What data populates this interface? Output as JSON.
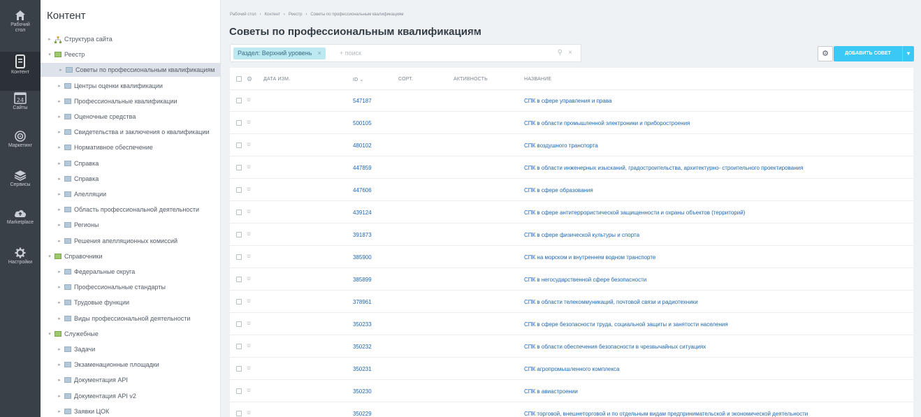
{
  "left_nav": [
    {
      "label_1": "Рабочий",
      "label_2": "стол",
      "icon": "home-icon"
    },
    {
      "label_1": "Контент",
      "label_2": "",
      "icon": "content-icon"
    },
    {
      "label_1": "Сайты",
      "label_2": "",
      "icon": "calendar-icon",
      "badge": "24"
    },
    {
      "label_1": "Маркетинг",
      "label_2": "",
      "icon": "target-icon"
    },
    {
      "label_1": "Сервисы",
      "label_2": "",
      "icon": "layers-icon"
    },
    {
      "label_1": "Marketplace",
      "label_2": "",
      "icon": "cloud-upload-icon"
    },
    {
      "label_1": "Настройки",
      "label_2": "",
      "icon": "gear-icon"
    }
  ],
  "tree": {
    "title": "Контент",
    "nodes": [
      {
        "label": "Структура сайта",
        "level": 0,
        "arrow": "▸",
        "icon": "sitemap"
      },
      {
        "label": "Реестр",
        "level": 0,
        "arrow": "▾",
        "icon": "green"
      },
      {
        "label": "Советы по профессиональным квалификациям",
        "level": 1,
        "arrow": "▸",
        "icon": "folder",
        "selected": true
      },
      {
        "label": "Центры оценки квалификации",
        "level": 1,
        "arrow": "▸",
        "icon": "folder"
      },
      {
        "label": "Профессиональные квалификации",
        "level": 1,
        "arrow": "▸",
        "icon": "folder"
      },
      {
        "label": "Оценочные средства",
        "level": 1,
        "arrow": "▸",
        "icon": "folder"
      },
      {
        "label": "Свидетельства и заключения о квалификации",
        "level": 1,
        "arrow": "▸",
        "icon": "folder"
      },
      {
        "label": "Нормативное обеспечение",
        "level": 1,
        "arrow": "▸",
        "icon": "folder"
      },
      {
        "label": "Справка",
        "level": 1,
        "arrow": "▸",
        "icon": "folder"
      },
      {
        "label": "Справка",
        "level": 1,
        "arrow": "▸",
        "icon": "folder"
      },
      {
        "label": "Апелляции",
        "level": 1,
        "arrow": "▸",
        "icon": "folder"
      },
      {
        "label": "Область профессиональной деятельности",
        "level": 1,
        "arrow": "▸",
        "icon": "folder"
      },
      {
        "label": "Регионы",
        "level": 1,
        "arrow": "▸",
        "icon": "folder"
      },
      {
        "label": "Решения апелляционных комиссий",
        "level": 1,
        "arrow": "▸",
        "icon": "folder"
      },
      {
        "label": "Справочники",
        "level": 0,
        "arrow": "▾",
        "icon": "green"
      },
      {
        "label": "Федеральные округа",
        "level": 1,
        "arrow": "▸",
        "icon": "folder"
      },
      {
        "label": "Профессиональные стандарты",
        "level": 1,
        "arrow": "▸",
        "icon": "folder"
      },
      {
        "label": "Трудовые функции",
        "level": 1,
        "arrow": "▸",
        "icon": "folder"
      },
      {
        "label": "Виды профессиональной деятельности",
        "level": 1,
        "arrow": "▸",
        "icon": "folder"
      },
      {
        "label": "Служебные",
        "level": 0,
        "arrow": "▾",
        "icon": "green"
      },
      {
        "label": "Задачи",
        "level": 1,
        "arrow": "▸",
        "icon": "folder"
      },
      {
        "label": "Экзаменационные площадки",
        "level": 1,
        "arrow": "▸",
        "icon": "folder"
      },
      {
        "label": "Документация API",
        "level": 1,
        "arrow": "▸",
        "icon": "folder"
      },
      {
        "label": "Документация API v2",
        "level": 1,
        "arrow": "▸",
        "icon": "folder"
      },
      {
        "label": "Заявки ЦОК",
        "level": 1,
        "arrow": "▸",
        "icon": "folder"
      }
    ]
  },
  "breadcrumbs": [
    "Рабочий стол",
    "Контент",
    "Реестр",
    "Советы по профессиональным квалификациям"
  ],
  "breadcrumb_sep": "›",
  "page_title": "Советы по профессиональным квалификациям",
  "star": "☆",
  "filter": {
    "chip_label": "Раздел: Верхний уровень",
    "chip_close": "×",
    "search_placeholder": "+ поиск",
    "search_icon": "⚲",
    "clear_icon": "×"
  },
  "toolbar": {
    "settings_icon": "⚙",
    "add_label": "ДОБАВИТЬ СОВЕТ",
    "dropdown_arrow": "▾"
  },
  "table": {
    "columns": [
      "ДАТА ИЗМ.",
      "ID ⌄",
      "СОРТ.",
      "АКТИВНОСТЬ",
      "НАЗВАНИЕ"
    ],
    "settings_icon": "⚙",
    "row_menu_icon": "≡",
    "rows": [
      {
        "id": "547187",
        "name": "СПК в сфере управления и права"
      },
      {
        "id": "500105",
        "name": "СПК в области промышленной электроники и приборостроения"
      },
      {
        "id": "480102",
        "name": "СПК воздушного транспорта"
      },
      {
        "id": "447859",
        "name": "СПК в области инженерных изысканий, градостроительства, архитектурно- строительного проектирования"
      },
      {
        "id": "447606",
        "name": "СПК в сфере образования"
      },
      {
        "id": "439124",
        "name": "СПК в сфере антитеррористической защищенности и охраны объектов (территорий)"
      },
      {
        "id": "391873",
        "name": "СПК в сфере физической культуры и спорта"
      },
      {
        "id": "385900",
        "name": "СПК на морском и внутреннем водном транспорте"
      },
      {
        "id": "385899",
        "name": "СПК в негосударственной сфере безопасности"
      },
      {
        "id": "378961",
        "name": "СПК в области телекоммуникаций, почтовой связи и радиотехники"
      },
      {
        "id": "350233",
        "name": "СПК в сфере безопасности труда, социальной защиты и занятости населения"
      },
      {
        "id": "350232",
        "name": "СПК в области обеспечения безопасности в чрезвычайных ситуациях"
      },
      {
        "id": "350231",
        "name": "СПК агропромышленного комплекса"
      },
      {
        "id": "350230",
        "name": "СПК в авиастроении"
      },
      {
        "id": "350229",
        "name": "СПК торговой, внешнеторговой и по отдельным видам предпринимательской и экономической деятельности"
      }
    ]
  }
}
